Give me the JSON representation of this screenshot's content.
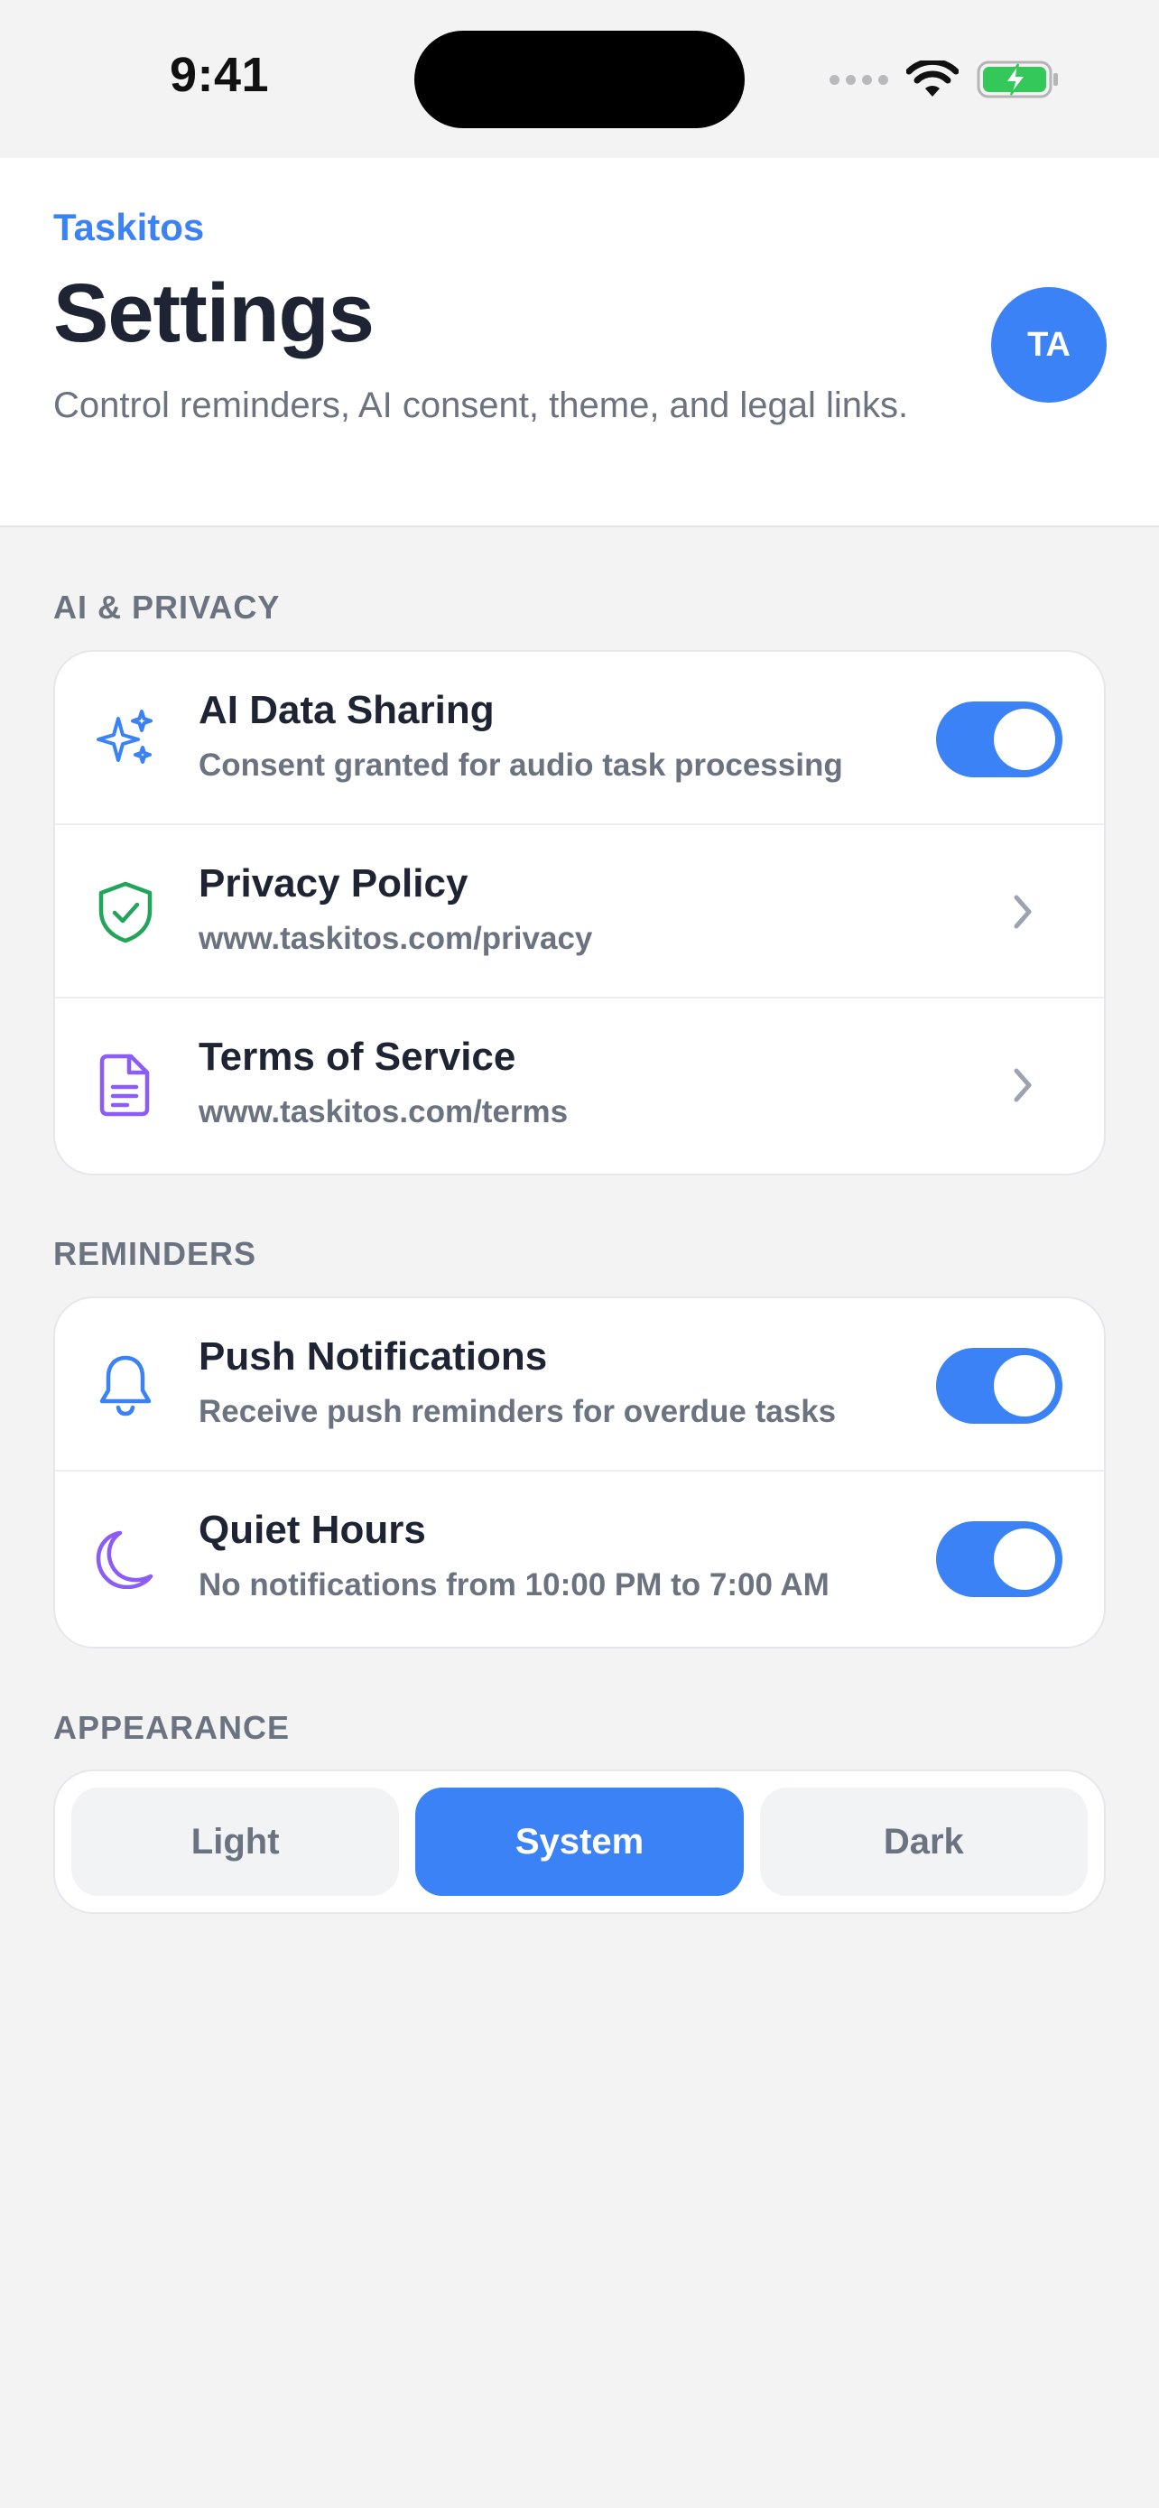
{
  "status_bar": {
    "time": "9:41"
  },
  "header": {
    "app_name": "Taskitos",
    "title": "Settings",
    "subtitle": "Control reminders, AI consent, theme, and legal links.",
    "avatar_initials": "TA"
  },
  "sections": {
    "ai_privacy": {
      "label": "AI & PRIVACY",
      "items": [
        {
          "title": "AI Data Sharing",
          "subtitle": "Consent granted for audio task processing",
          "icon": "sparkles-icon",
          "control": "toggle",
          "enabled": true
        },
        {
          "title": "Privacy Policy",
          "subtitle": "www.taskitos.com/privacy",
          "icon": "shield-check-icon",
          "control": "chevron"
        },
        {
          "title": "Terms of Service",
          "subtitle": "www.taskitos.com/terms",
          "icon": "document-icon",
          "control": "chevron"
        }
      ]
    },
    "reminders": {
      "label": "REMINDERS",
      "items": [
        {
          "title": "Push Notifications",
          "subtitle": "Receive push reminders for overdue tasks",
          "icon": "bell-icon",
          "control": "toggle",
          "enabled": true
        },
        {
          "title": "Quiet Hours",
          "subtitle": "No notifications from 10:00 PM to 7:00 AM",
          "icon": "moon-icon",
          "control": "toggle",
          "enabled": true
        }
      ]
    },
    "appearance": {
      "label": "APPEARANCE",
      "options": [
        "Light",
        "System",
        "Dark"
      ],
      "selected": "System"
    }
  },
  "colors": {
    "accent": "#3b82f6",
    "shield": "#22a55b",
    "document": "#8b5cf6",
    "moon": "#8b5cf6",
    "battery": "#34c759"
  }
}
